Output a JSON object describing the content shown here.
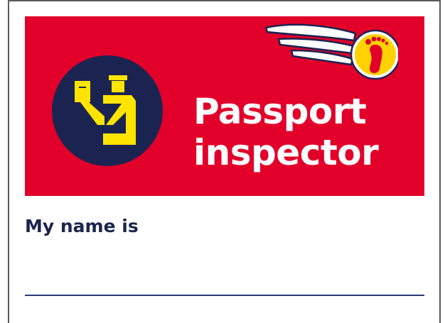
{
  "badge": {
    "title_line1": "Passport",
    "title_line2": "inspector",
    "name_prompt": "My name is"
  },
  "icons": {
    "inspector": "passport-inspector-icon",
    "logo": "winged-footprint-logo"
  },
  "colors": {
    "banner_red": "#e2002b",
    "icon_circle_navy": "#1b2450",
    "icon_figure_yellow": "#ffe400",
    "text_navy": "#1b2450",
    "logo_yellow": "#ffd200",
    "logo_footprint_red": "#e2002b",
    "name_line": "#2a3a7a",
    "card_border": "#5a5a5a",
    "corner_mark_purple": "#5b2a68"
  }
}
